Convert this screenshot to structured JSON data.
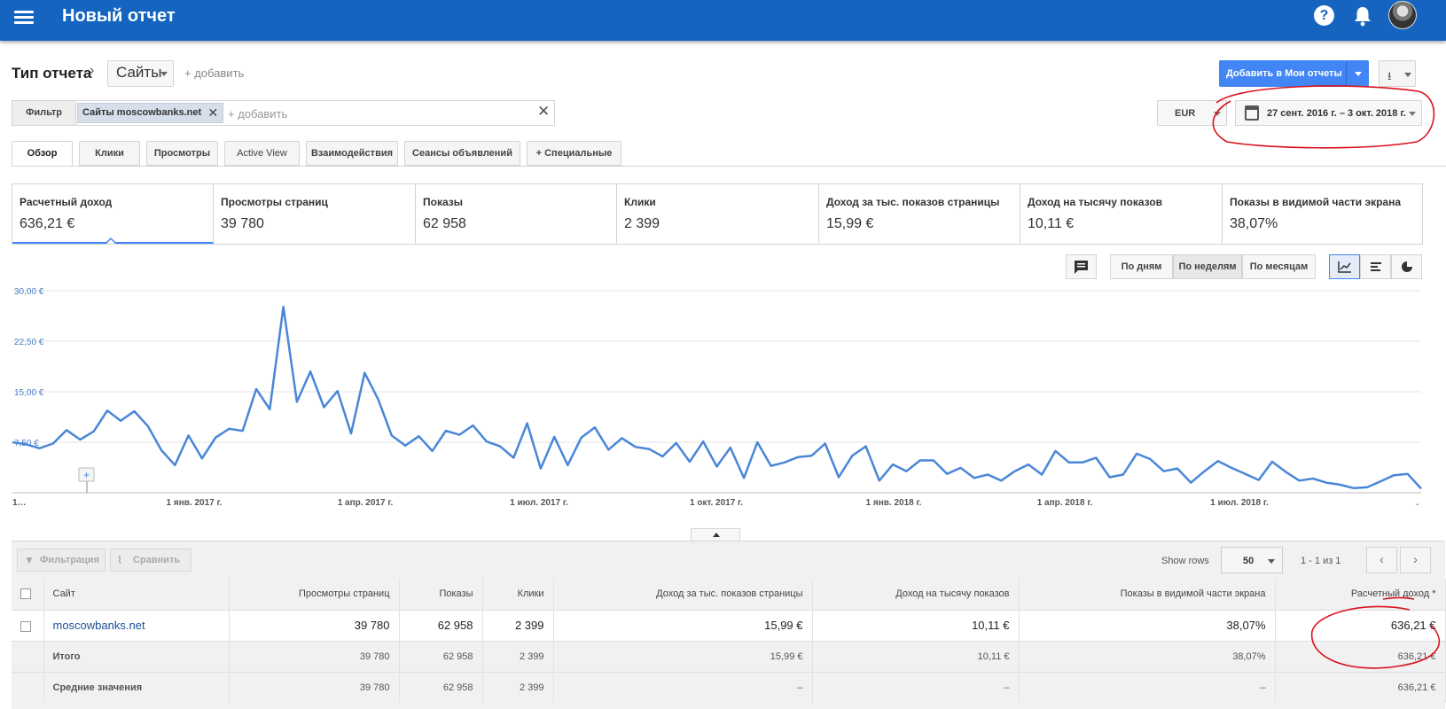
{
  "header": {
    "title": "Новый отчет",
    "help": "?"
  },
  "report_type": {
    "label": "Тип отчета",
    "chevron": "›",
    "dropdown": "Сайты",
    "add": "+ добавить"
  },
  "actions": {
    "add_to_reports": "Добавить в Мои отчеты",
    "download_arrow": "⭳"
  },
  "filter": {
    "label": "Фильтр",
    "chip": "Сайты moscowbanks.net",
    "chip_remove": "✕",
    "add_placeholder": "+ добавить",
    "clear": "✕"
  },
  "currency": "EUR",
  "date_range": "27 сент. 2016 г. – 3 окт. 2018 г.",
  "tabs": [
    "Обзор",
    "Клики",
    "Просмотры",
    "Active View",
    "Взаимодействия",
    "Сеансы объявлений",
    "Специальные"
  ],
  "tab_plus": "+",
  "metrics": [
    {
      "label": "Расчетный доход",
      "value": "636,21 €"
    },
    {
      "label": "Просмотры страниц",
      "value": "39 780"
    },
    {
      "label": "Показы",
      "value": "62 958"
    },
    {
      "label": "Клики",
      "value": "2 399"
    },
    {
      "label": "Доход за тыс. показов страницы",
      "value": "15,99 €"
    },
    {
      "label": "Доход на тысячу показов",
      "value": "10,11 €"
    },
    {
      "label": "Показы в видимой части экрана",
      "value": "38,07%"
    }
  ],
  "granularity": [
    "По дням",
    "По неделям",
    "По месяцам"
  ],
  "selected_granularity": "По неделям",
  "chart_data": {
    "type": "line",
    "ylim": [
      0,
      30
    ],
    "y_ticks": [
      "30,00 €",
      "22,50 €",
      "15,00 €",
      "7,50 €"
    ],
    "y_tick_values": [
      30,
      22.5,
      15,
      7.5
    ],
    "x_labels": [
      "1…",
      "1 янв. 2017 г.",
      "1 апр. 2017 г.",
      "1 июл. 2017 г.",
      "1 окт. 2017 г.",
      "1 янв. 2018 г.",
      "1 апр. 2018 г.",
      "1 июл. 2018 г.",
      "."
    ],
    "series_color": "#4a86d8",
    "series": [
      {
        "values": [
          7.5,
          7.2,
          6.6,
          7.3,
          9.3,
          7.9,
          9.1,
          12.2,
          10.7,
          12.1,
          9.9,
          6.3,
          4.1,
          8.5,
          5.1,
          8.2,
          9.5,
          9.2,
          15.4,
          12.4,
          27.6,
          13.5,
          18.0,
          12.7,
          15.1,
          8.8,
          17.8,
          13.9,
          8.5,
          7.0,
          8.4,
          6.2,
          9.2,
          8.6,
          10.0,
          7.6,
          6.9,
          5.2,
          10.3,
          3.6,
          8.3,
          4.1,
          8.2,
          9.7,
          6.4,
          8.1,
          6.8,
          6.5,
          5.4,
          7.4,
          4.6,
          7.6,
          3.9,
          6.7,
          2.2,
          7.5,
          4.0,
          4.5,
          5.3,
          5.5,
          7.3,
          2.3,
          5.5,
          6.9,
          1.8,
          4.2,
          3.2,
          4.8,
          4.8,
          2.8,
          3.7,
          2.2,
          2.7,
          1.8,
          3.2,
          4.2,
          2.7,
          6.2,
          4.5,
          4.5,
          5.2,
          2.3,
          2.7,
          5.8,
          5.0,
          3.2,
          3.6,
          1.5,
          3.2,
          4.7,
          3.7,
          2.8,
          1.9,
          4.6,
          3.1,
          1.8,
          2.1,
          1.5,
          1.2,
          0.7,
          0.8,
          1.7,
          2.6,
          2.8,
          0.6
        ]
      }
    ]
  },
  "table": {
    "filter_btn": "Фильтрация",
    "compare_btn": "Сравнить",
    "show_rows_label": "Show rows",
    "rows_value": "50",
    "pager": "1 - 1 из 1",
    "prev": "‹",
    "next": "›",
    "columns": [
      "Сайт",
      "Просмотры страниц",
      "Показы",
      "Клики",
      "Доход за тыс. показов страницы",
      "Доход на тысячу показов",
      "Показы в видимой части экрана",
      "Расчетный доход *"
    ],
    "rows": [
      [
        "moscowbanks.net",
        "39 780",
        "62 958",
        "2 399",
        "15,99 €",
        "10,11 €",
        "38,07%",
        "636,21 €"
      ]
    ],
    "totals": [
      "Итого",
      "39 780",
      "62 958",
      "2 399",
      "15,99 €",
      "10,11 €",
      "38,07%",
      "636,21 €"
    ],
    "averages": [
      "Средние значения",
      "39 780",
      "62 958",
      "2 399",
      "–",
      "–",
      "–",
      "636,21 €"
    ]
  }
}
